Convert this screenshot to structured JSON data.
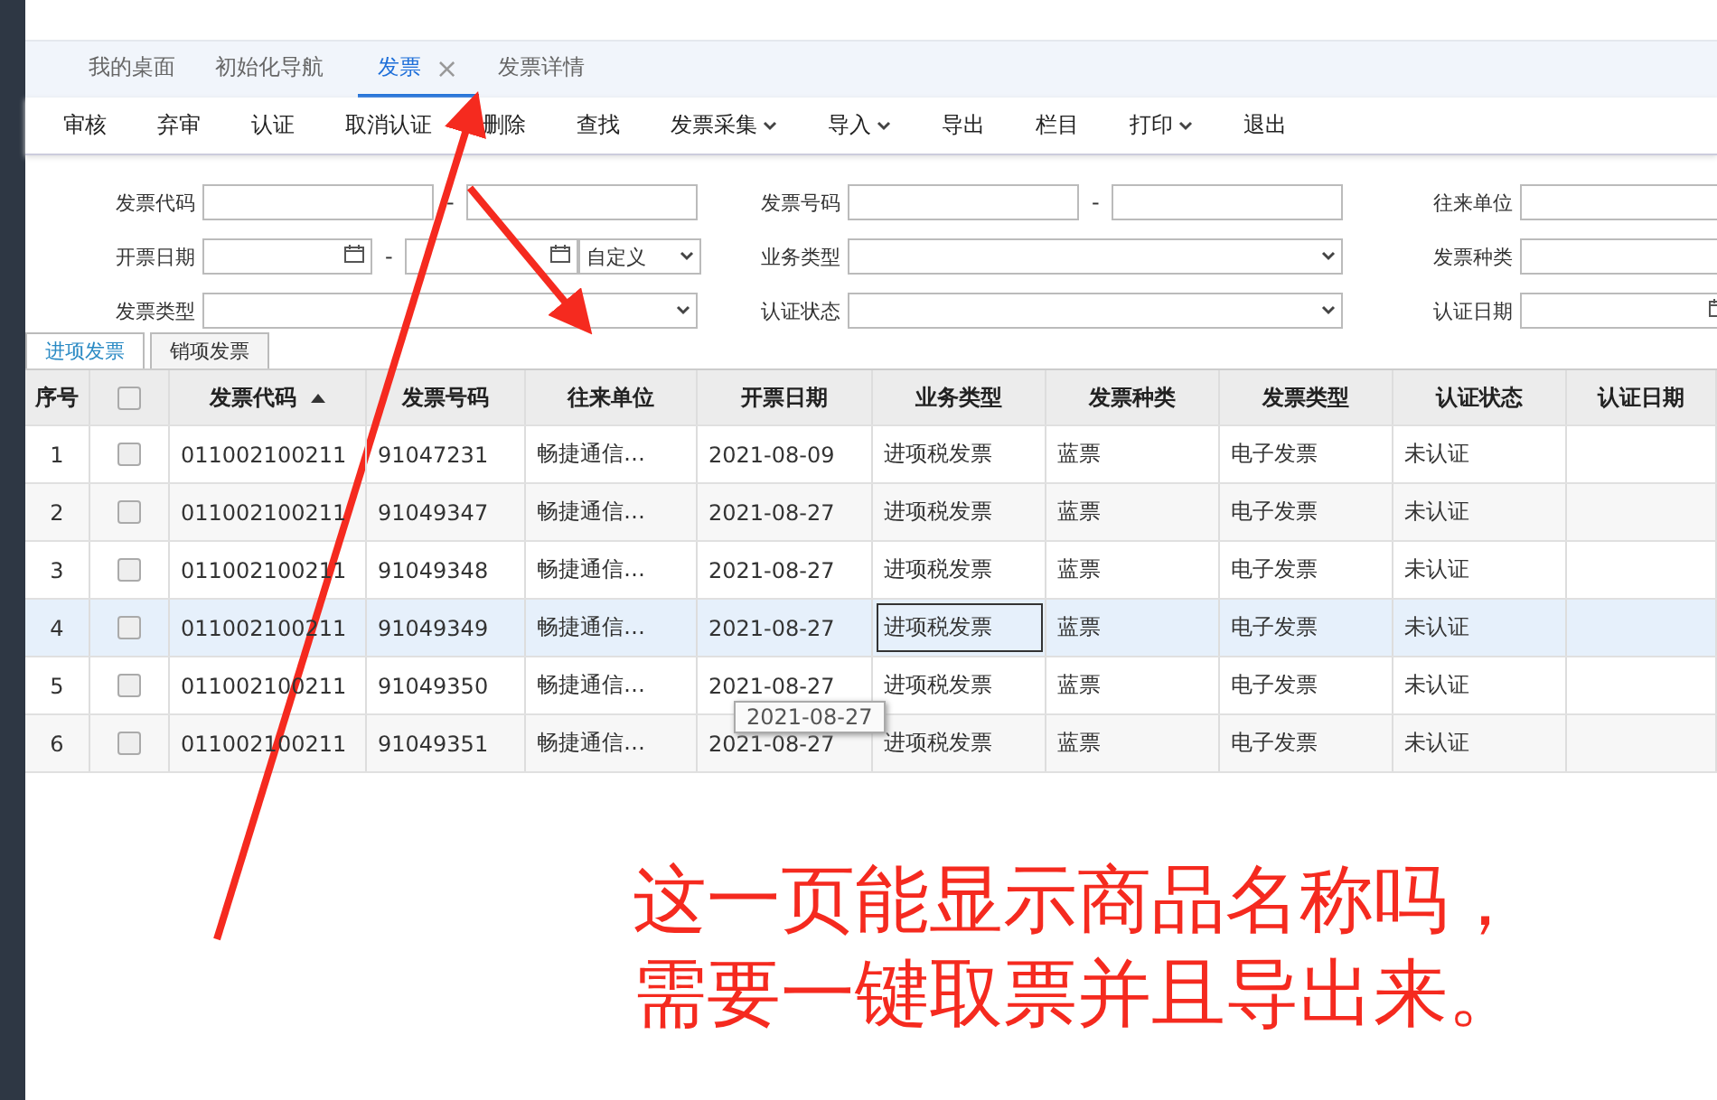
{
  "tabs": [
    {
      "label": "我的桌面",
      "selected": false,
      "closable": false
    },
    {
      "label": "初始化导航",
      "selected": false,
      "closable": false
    },
    {
      "label": "发票",
      "selected": true,
      "closable": true,
      "close": "×"
    },
    {
      "label": "发票详情",
      "selected": false,
      "closable": false
    }
  ],
  "toolbar": [
    {
      "label": "审核",
      "dropdown": false
    },
    {
      "label": "弃审",
      "dropdown": false
    },
    {
      "label": "认证",
      "dropdown": false
    },
    {
      "label": "取消认证",
      "dropdown": false
    },
    {
      "label": "删除",
      "dropdown": false
    },
    {
      "label": "查找",
      "dropdown": false
    },
    {
      "label": "发票采集",
      "dropdown": true
    },
    {
      "label": "导入",
      "dropdown": true
    },
    {
      "label": "导出",
      "dropdown": false
    },
    {
      "label": "栏目",
      "dropdown": false
    },
    {
      "label": "打印",
      "dropdown": true
    },
    {
      "label": "退出",
      "dropdown": false
    }
  ],
  "filters": [
    {
      "label": "发票代码",
      "kind": "range",
      "separator": "-"
    },
    {
      "label": "发票号码",
      "kind": "range",
      "separator": "-"
    },
    {
      "label": "往来单位",
      "kind": "text"
    },
    {
      "label": "开票日期",
      "kind": "date_range",
      "separator": "-",
      "value": "自定义"
    },
    {
      "label": "业务类型",
      "kind": "select"
    },
    {
      "label": "发票种类",
      "kind": "text"
    },
    {
      "label": "发票类型",
      "kind": "select"
    },
    {
      "label": "认证状态",
      "kind": "select"
    },
    {
      "label": "认证日期",
      "kind": "date"
    }
  ],
  "subtabs": [
    {
      "label": "进项发票",
      "selected": true
    },
    {
      "label": "销项发票",
      "selected": false
    }
  ],
  "table": {
    "columns": [
      {
        "label": "序号",
        "kind": "text",
        "sorted": false
      },
      {
        "kind": "check",
        "checked": false
      },
      {
        "label": "发票代码",
        "kind": "text",
        "sorted": true
      },
      {
        "label": "发票号码",
        "kind": "text",
        "sorted": false
      },
      {
        "label": "往来单位",
        "kind": "text",
        "sorted": false
      },
      {
        "label": "开票日期",
        "kind": "text",
        "sorted": false
      },
      {
        "label": "业务类型",
        "kind": "text",
        "sorted": false
      },
      {
        "label": "发票种类",
        "kind": "text",
        "sorted": false
      },
      {
        "label": "发票类型",
        "kind": "text",
        "sorted": false
      },
      {
        "label": "认证状态",
        "kind": "text",
        "sorted": false
      },
      {
        "label": "认证日期",
        "kind": "text",
        "sorted": false
      }
    ],
    "rows": [
      {
        "selected": false,
        "checked": false,
        "cells": [
          "1",
          "",
          "011002100211",
          "91047231",
          "畅捷通信…",
          "2021-08-09",
          "进项税发票",
          "蓝票",
          "电子发票",
          "未认证",
          ""
        ]
      },
      {
        "selected": false,
        "checked": false,
        "cells": [
          "2",
          "",
          "011002100211",
          "91049347",
          "畅捷通信…",
          "2021-08-27",
          "进项税发票",
          "蓝票",
          "电子发票",
          "未认证",
          ""
        ]
      },
      {
        "selected": false,
        "checked": false,
        "cells": [
          "3",
          "",
          "011002100211",
          "91049348",
          "畅捷通信…",
          "2021-08-27",
          "进项税发票",
          "蓝票",
          "电子发票",
          "未认证",
          ""
        ]
      },
      {
        "selected": true,
        "checked": false,
        "cells": [
          "4",
          "",
          "011002100211",
          "91049349",
          "畅捷通信…",
          "2021-08-27",
          "进项税发票",
          "蓝票",
          "电子发票",
          "未认证",
          ""
        ]
      },
      {
        "selected": false,
        "checked": false,
        "cells": [
          "5",
          "",
          "011002100211",
          "91049350",
          "畅捷通信…",
          "2021-08-27",
          "进项税发票",
          "蓝票",
          "电子发票",
          "未认证",
          ""
        ]
      },
      {
        "selected": false,
        "checked": false,
        "cells": [
          "6",
          "",
          "011002100211",
          "91049351",
          "畅捷通信…",
          "2021-08-27",
          "进项税发票",
          "蓝票",
          "电子发票",
          "未认证",
          ""
        ]
      }
    ]
  },
  "tooltip": "2021-08-27",
  "annotation": [
    "这一页能显示商品名称吗，",
    "需要一键取票并且导出来。"
  ]
}
